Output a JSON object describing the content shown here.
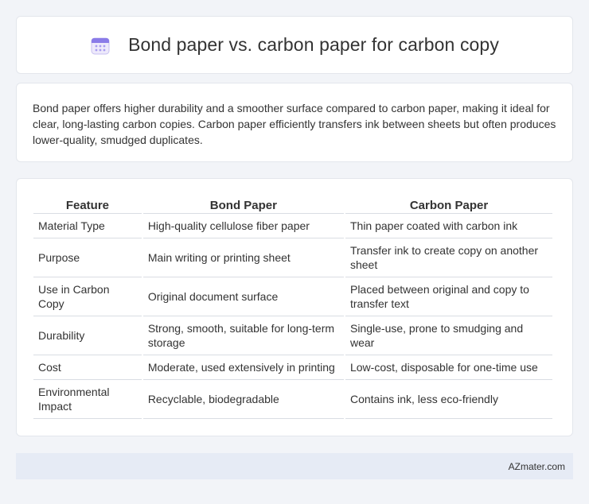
{
  "header": {
    "title": "Bond paper vs. carbon paper for carbon copy",
    "icon": "calendar-icon",
    "icon_color": "#7b68ee"
  },
  "summary": {
    "text": "Bond paper offers higher durability and a smoother surface compared to carbon paper, making it ideal for clear, long-lasting carbon copies. Carbon paper efficiently transfers ink between sheets but often produces lower-quality, smudged duplicates."
  },
  "table": {
    "headers": [
      "Feature",
      "Bond Paper",
      "Carbon Paper"
    ],
    "rows": [
      [
        "Material Type",
        "High-quality cellulose fiber paper",
        "Thin paper coated with carbon ink"
      ],
      [
        "Purpose",
        "Main writing or printing sheet",
        "Transfer ink to create copy on another sheet"
      ],
      [
        "Use in Carbon Copy",
        "Original document surface",
        "Placed between original and copy to transfer text"
      ],
      [
        "Durability",
        "Strong, smooth, suitable for long-term storage",
        "Single-use, prone to smudging and wear"
      ],
      [
        "Cost",
        "Moderate, used extensively in printing",
        "Low-cost, disposable for one-time use"
      ],
      [
        "Environmental Impact",
        "Recyclable, biodegradable",
        "Contains ink, less eco-friendly"
      ]
    ]
  },
  "footer": {
    "brand": "AZmater.com"
  }
}
